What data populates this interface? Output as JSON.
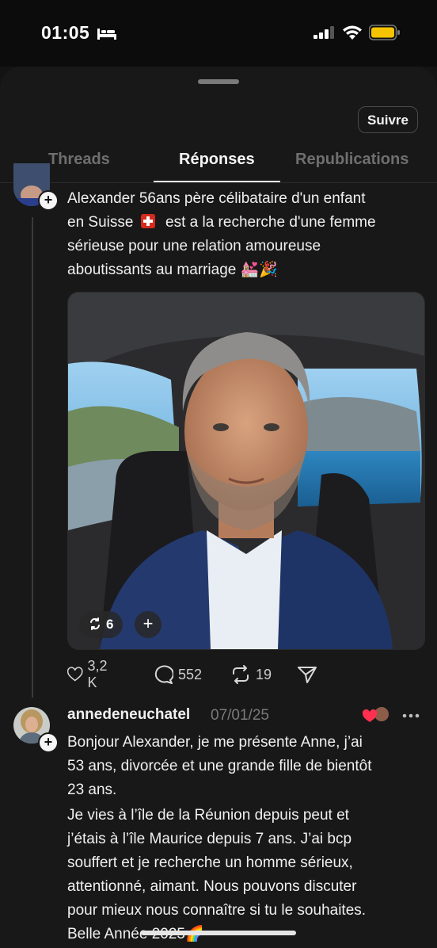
{
  "status_bar": {
    "time": "01:05"
  },
  "profile": {
    "follow_label": "Suivre"
  },
  "tabs": [
    {
      "label": "Threads"
    },
    {
      "label": "Réponses"
    },
    {
      "label": "Republications"
    }
  ],
  "post": {
    "lines": [
      "Alexander 56ans père célibataire d'un enfant",
      "en Suisse",
      "est a la recherche d'une femme",
      "sérieuse pour une relation amoureuse",
      "aboutissants au marriage 💒🎉"
    ],
    "media": {
      "reposts": "6"
    },
    "likes": "3,2 K",
    "comments": "552",
    "reposts": "19"
  },
  "reply": {
    "username": "annedeneuchatel",
    "date": "07/01/25",
    "lines": [
      "Bonjour Alexander, je me présente Anne, j’ai",
      "53 ans, divorcée et une grande fille de bientôt",
      "23 ans.",
      "Je vies à l’île de la Réunion depuis peut et",
      "j’étais à l’île Maurice depuis 7 ans. J’ai bcp",
      "souffert et je recherche un homme sérieux,",
      "attentionné, aimant. Nous pouvons discuter",
      "pour mieux nous connaître si tu le souhaites.",
      "Belle Année 2025🌈"
    ]
  },
  "colors": {
    "background": "#181818",
    "accent": "#f5f5f5",
    "muted": "#6f6f6f"
  }
}
